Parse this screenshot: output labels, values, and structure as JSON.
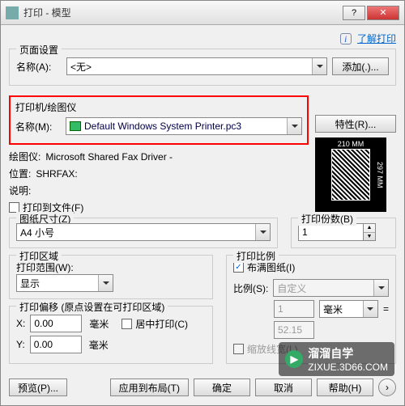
{
  "window": {
    "title": "打印 - 模型"
  },
  "help": {
    "link": "了解打印"
  },
  "page_setup": {
    "legend": "页面设置",
    "name_label": "名称(A):",
    "name_value": "<无>",
    "add_btn": "添加(.)..."
  },
  "printer": {
    "legend": "打印机/绘图仪",
    "name_label": "名称(M):",
    "name_value": "Default Windows System Printer.pc3",
    "props_btn": "特性(R)...",
    "plotter_label": "绘图仪:",
    "plotter_value": "Microsoft Shared Fax Driver -",
    "location_label": "位置:",
    "location_value": "SHRFAX:",
    "desc_label": "说明:",
    "to_file_label": "打印到文件(F)",
    "preview": {
      "width": "210 MM",
      "height": "297 MM"
    }
  },
  "paper": {
    "legend": "图纸尺寸(Z)",
    "value": "A4 小号"
  },
  "copies": {
    "legend": "打印份数(B)",
    "value": "1"
  },
  "area": {
    "legend": "打印区域",
    "scope_label": "打印范围(W):",
    "scope_value": "显示"
  },
  "scale": {
    "legend": "打印比例",
    "fit_label": "布满图纸(I)",
    "fit_checked": true,
    "ratio_label": "比例(S):",
    "ratio_value": "自定义",
    "units_value": "1",
    "units_unit": "毫米",
    "drawing_value": "52.15",
    "lw_label": "缩放线宽(L)"
  },
  "offset": {
    "legend": "打印偏移 (原点设置在可打印区域)",
    "x_label": "X:",
    "x_value": "0.00",
    "y_label": "Y:",
    "y_value": "0.00",
    "unit": "毫米",
    "center_label": "居中打印(C)"
  },
  "footer": {
    "preview": "预览(P)...",
    "apply": "应用到布局(T)",
    "ok": "确定",
    "cancel": "取消",
    "help": "帮助(H)"
  },
  "watermark": {
    "brand": "溜溜自学",
    "site": "ZIXUE.3D66.COM"
  }
}
